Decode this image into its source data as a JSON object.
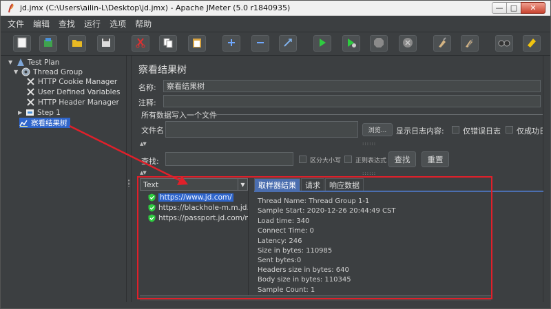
{
  "window": {
    "title": "jd.jmx (C:\\Users\\ailin-L\\Desktop\\jd.jmx) - Apache JMeter (5.0 r1840935)",
    "controls": {
      "minimize": "—",
      "maximize": "□",
      "close": "✕"
    }
  },
  "menu": [
    "文件",
    "编辑",
    "查找",
    "运行",
    "选项",
    "帮助"
  ],
  "toolbar_icons": [
    "new-icon",
    "templates-icon",
    "open-icon",
    "save-icon",
    "cut-icon",
    "copy-icon",
    "paste-icon",
    "expand-icon",
    "collapse-icon",
    "toggle-icon",
    "start-icon",
    "start-no-pause-icon",
    "stop-icon",
    "shutdown-icon",
    "clear-icon",
    "clear-all-icon",
    "search-icon",
    "reset-search-icon"
  ],
  "tree": {
    "items": [
      {
        "label": "Test Plan",
        "icon": "test-plan-icon"
      },
      {
        "label": "Thread Group",
        "icon": "thread-group-icon"
      },
      {
        "label": "HTTP Cookie Manager",
        "icon": "config-icon"
      },
      {
        "label": "User Defined Variables",
        "icon": "config-icon"
      },
      {
        "label": "HTTP Header Manager",
        "icon": "config-icon"
      },
      {
        "label": "Step 1",
        "icon": "controller-icon"
      },
      {
        "label": "察看结果树",
        "icon": "listener-icon"
      }
    ]
  },
  "panel": {
    "title": "察看结果树",
    "name_label": "名称:",
    "name_value": "察看结果树",
    "comment_label": "注释:",
    "comment_value": "",
    "file_group": "所有数据写入一个文件",
    "filename_label": "文件名",
    "filename_value": "",
    "browse_button": "浏览...",
    "log_display_label": "显示日志内容:",
    "errors_only_label": "仅错误日志",
    "success_only_label": "仅成功日志",
    "search_label": "查找:",
    "search_value": "",
    "case_sensitive_label": "区分大小写",
    "regex_label": "正则表达式",
    "search_button": "查找",
    "reset_button": "重置"
  },
  "results": {
    "renderer": "Text",
    "samples": [
      "https://www.jd.com/",
      "https://blackhole-m.m.jd.com",
      "https://passport.jd.com/new/l"
    ],
    "tabs": [
      "取样器结果",
      "请求",
      "响应数据"
    ],
    "details": [
      "Thread Name: Thread Group 1-1",
      "Sample Start: 2020-12-26 20:44:49 CST",
      "Load time: 340",
      "Connect Time: 0",
      "Latency: 246",
      "Size in bytes: 110985",
      "Sent bytes:0",
      "Headers size in bytes: 640",
      "Body size in bytes: 110345",
      "Sample Count: 1"
    ]
  },
  "colors": {
    "annotation": "#e0202a",
    "selection": "#2f65ca",
    "background": "#3c3f41",
    "active_tab": "#4b6eaf"
  }
}
